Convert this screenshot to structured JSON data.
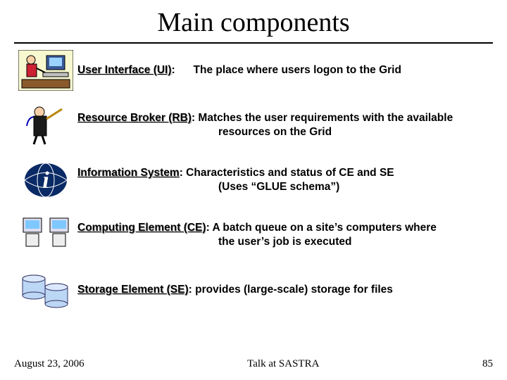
{
  "title": "Main components",
  "items": [
    {
      "term": "User Interface (UI)",
      "sep": ":",
      "desc_main": "The place where users logon to the Grid",
      "desc_sub": ""
    },
    {
      "term": "Resource Broker (RB)",
      "sep": ":",
      "desc_main": " Matches the user requirements with the available",
      "desc_sub": "resources on the Grid"
    },
    {
      "term": "Information System",
      "sep": ":",
      "desc_main": " Characteristics and status of CE and SE",
      "desc_sub": "(Uses “GLUE schema”)"
    },
    {
      "term": "Computing Element (CE)",
      "sep": ":",
      "desc_main": " A batch queue on a site’s computers where",
      "desc_sub": "the user’s job is executed"
    },
    {
      "term": "Storage Element (SE)",
      "sep": ":",
      "desc_main": " provides (large-scale) storage for files",
      "desc_sub": ""
    }
  ],
  "footer": {
    "date": "August 23, 2006",
    "center": "Talk at SASTRA",
    "page": "85"
  }
}
